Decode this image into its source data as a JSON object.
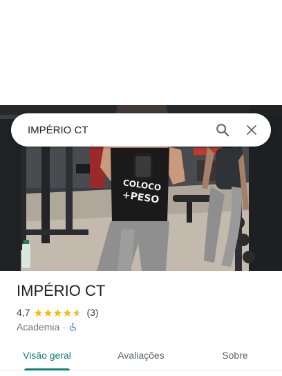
{
  "search": {
    "query": "IMPÉRIO CT"
  },
  "place": {
    "name": "IMPÉRIO CT",
    "rating": "4,7",
    "stars": 4.7,
    "review_count": "(3)",
    "category": "Academia",
    "separator": "·"
  },
  "shirt_text": {
    "line1": "COLOCO",
    "line2": "+PESO"
  },
  "tabs": [
    {
      "label": "Visão geral",
      "active": true
    },
    {
      "label": "Avaliações",
      "active": false
    },
    {
      "label": "Sobre",
      "active": false
    }
  ],
  "colors": {
    "accent": "#0b8079",
    "star": "#fbbc04",
    "accessibility": "#1a73e8"
  }
}
